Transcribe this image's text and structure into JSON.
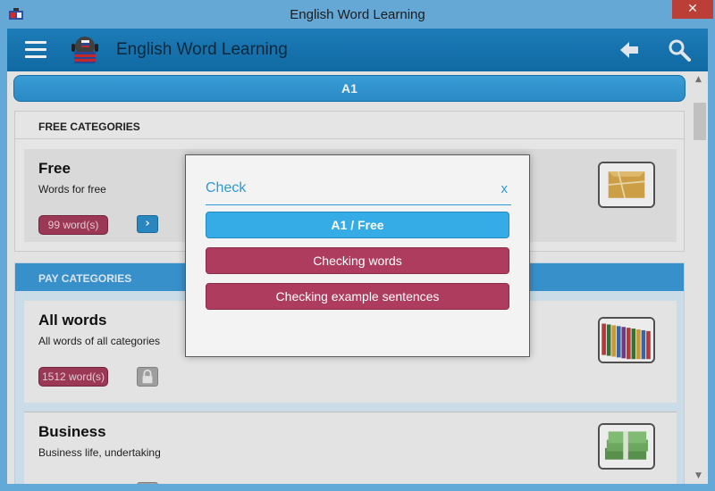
{
  "window": {
    "title": "English Word Learning",
    "close_glyph": "✕"
  },
  "appbar": {
    "title": "English Word Learning",
    "icons": [
      "menu-icon",
      "app-logo-icon",
      "back-arrow-icon",
      "search-icon"
    ]
  },
  "level_bar": {
    "label": "A1"
  },
  "free_section": {
    "header": "FREE CATEGORIES",
    "card": {
      "title": "Free",
      "description": "Words for free",
      "word_count": "99 word(s)",
      "go_glyph": "›",
      "thumbnail": "gift-box-icon"
    }
  },
  "pay_section": {
    "header": "PAY CATEGORIES",
    "cards": [
      {
        "title": "All words",
        "description": "All words of all categories",
        "word_count": "1512 word(s)",
        "thumbnail": "books-row-icon",
        "locked": true
      },
      {
        "title": "Business",
        "description": "Business life, undertaking",
        "word_count": "",
        "thumbnail": "money-stack-icon",
        "locked": true
      }
    ]
  },
  "dialog": {
    "title": "Check",
    "close_label": "x",
    "level_button": "A1 / Free",
    "words_button": "Checking words",
    "sentences_button": "Checking example sentences"
  },
  "colors": {
    "accent_blue": "#2c9ad6",
    "header_blue": "#1270ad",
    "badge_crimson": "#ad3c5e",
    "titlebar": "#6cb3e4"
  },
  "scrollbar": {
    "position": 0.05
  }
}
